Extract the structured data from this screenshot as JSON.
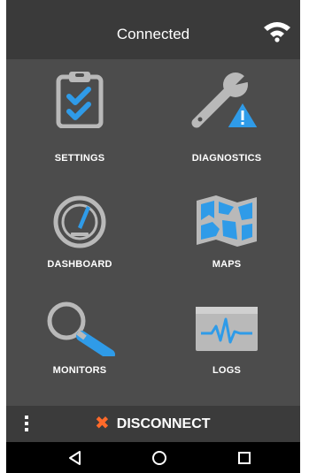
{
  "status": {
    "title": "Connected",
    "icon": "wifi-icon"
  },
  "tiles": [
    {
      "label": "SETTINGS",
      "icon": "clipboard-checklist-icon"
    },
    {
      "label": "DIAGNOSTICS",
      "icon": "wrench-warning-icon"
    },
    {
      "label": "DASHBOARD",
      "icon": "speedometer-icon"
    },
    {
      "label": "MAPS",
      "icon": "map-icon"
    },
    {
      "label": "MONITORS",
      "icon": "magnifier-icon"
    },
    {
      "label": "LOGS",
      "icon": "waveform-screen-icon"
    }
  ],
  "bottom": {
    "disconnect_label": "DISCONNECT",
    "menu_icon": "overflow-menu-icon",
    "disconnect_icon": "close-x-icon"
  },
  "navigation": {
    "back_icon": "back-triangle-icon",
    "home_icon": "home-circle-icon",
    "recents_icon": "recents-square-icon"
  },
  "colors": {
    "accent_blue": "#2f9be8",
    "disconnect_x": "#ff6a2a",
    "icon_gray": "#b5b5b5",
    "background": "#4c4c4c",
    "bar": "#3b3b3b"
  }
}
